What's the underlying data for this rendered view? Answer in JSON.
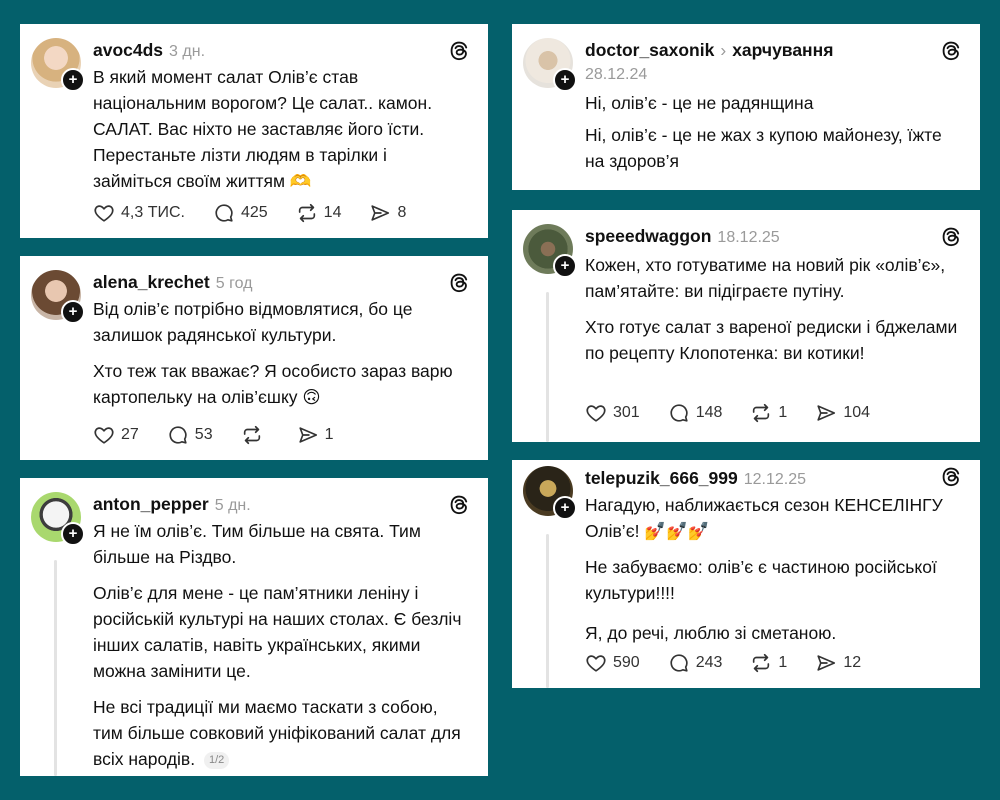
{
  "posts": [
    {
      "username": "avoc4ds",
      "time": "3 дн.",
      "paragraphs": [
        "В який момент салат Олів’є став національним ворогом? Це салат.. камон. САЛАТ. Вас ніхто не заставляє його їсти. Перестаньте лізти людям в тарілки і займіться своїм життям 🫶"
      ],
      "likes": "4,3 ТИС.",
      "replies": "425",
      "reposts": "14",
      "shares": "8"
    },
    {
      "username": "alena_krechet",
      "time": "5 год",
      "paragraphs": [
        "Від олів’є потрібно відмовлятися, бо це залишок радянської культури.",
        "Хто теж так вважає? Я особисто зараз варю картопельку на олів’єшку 🙃"
      ],
      "likes": "27",
      "replies": "53",
      "reposts": "",
      "shares": "1"
    },
    {
      "username": "anton_pepper",
      "time": "5 дн.",
      "paragraphs": [
        "Я не їм олів’є. Тим більше на свята. Тим більше на Різдво.",
        "Олів’є для мене - це пам’ятники леніну і російській культурі на наших столах. Є безліч інших салатів, навіть українських, якими можна замінити це.",
        "Не всі традиції ми маємо таскати з собою, тим більше совковий уніфікований салат для всіх народів."
      ],
      "page": "1/2"
    },
    {
      "username": "doctor_saxonik",
      "topic_sep": "›",
      "topic": "харчування",
      "time": "28.12.24",
      "paragraphs": [
        "Ні, олів’є - це не радянщина",
        "Ні, олів’є - це не жах з купою майонезу, їжте на здоров’я"
      ]
    },
    {
      "username": "speeedwaggon",
      "time": "18.12.25",
      "paragraphs": [
        "Кожен, хто готуватиме на новий рік «олів’є», пам’ятайте: ви підіграєте путіну.",
        "Хто готує салат з вареної редиски і бджелами по рецепту Клопотенка: ви котики!"
      ],
      "likes": "301",
      "replies": "148",
      "reposts": "1",
      "shares": "104"
    },
    {
      "username": "telepuzik_666_999",
      "time": "12.12.25",
      "paragraphs": [
        "Нагадую, наближається сезон КЕНСЕЛІНГУ Олів’є! 💅💅💅",
        "Не забуваємо: олів’є є частиною російської культури!!!!",
        "Я, до речі, люблю зі сметаною."
      ],
      "likes": "590",
      "replies": "243",
      "reposts": "1",
      "shares": "12"
    }
  ],
  "icons": {
    "like": "heart-icon",
    "reply": "comment-icon",
    "repost": "repost-icon",
    "share": "share-icon",
    "brand": "threads-logo-icon",
    "follow": "plus-icon"
  },
  "colors": {
    "background": "#04606b",
    "card": "#ffffff",
    "muted": "#9a9a9a"
  }
}
